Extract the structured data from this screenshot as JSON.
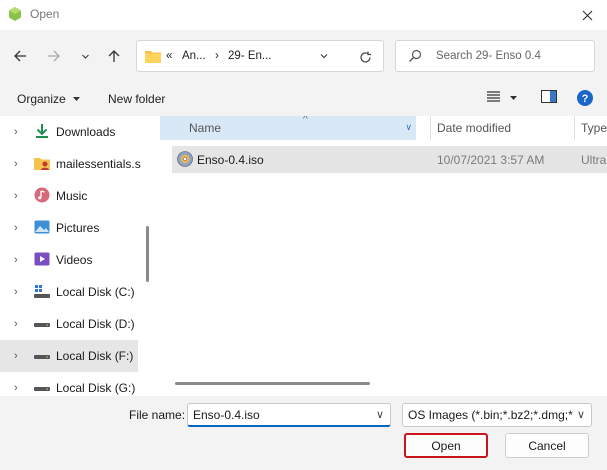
{
  "window": {
    "title": "Open"
  },
  "nav": {
    "breadcrumb_overflow": "«",
    "breadcrumbs": [
      "An...",
      "29- En..."
    ],
    "separator": "›",
    "search_placeholder": "Search 29- Enso 0.4"
  },
  "toolbar": {
    "organize_label": "Organize",
    "new_folder_label": "New folder"
  },
  "sidebar": {
    "items": [
      {
        "label": "Downloads",
        "icon": "download-icon"
      },
      {
        "label": "mailessentials.s",
        "icon": "user-folder-icon"
      },
      {
        "label": "Music",
        "icon": "music-icon"
      },
      {
        "label": "Pictures",
        "icon": "pictures-icon"
      },
      {
        "label": "Videos",
        "icon": "videos-icon"
      },
      {
        "label": "Local Disk (C:)",
        "icon": "windows-drive-icon"
      },
      {
        "label": "Local Disk (D:)",
        "icon": "drive-icon"
      },
      {
        "label": "Local Disk (F:)",
        "icon": "drive-icon",
        "selected": true
      },
      {
        "label": "Local Disk (G:)",
        "icon": "drive-icon"
      }
    ]
  },
  "filelist": {
    "columns": {
      "name": "Name",
      "date": "Date modified",
      "type": "Type"
    },
    "rows": [
      {
        "name": "Enso-0.4.iso",
        "date": "10/07/2021 3:57 AM",
        "type": "Ultra",
        "icon": "disc-image-icon"
      }
    ]
  },
  "bottom": {
    "filename_label": "File name:",
    "filename_value": "Enso-0.4.iso",
    "filetype_value": "OS Images (*.bin;*.bz2;*.dmg;*.",
    "open_label": "Open",
    "cancel_label": "Cancel"
  },
  "colors": {
    "accent": "#0a64c4",
    "highlight_border": "#c8151b",
    "header_selected": "#d9e8f7"
  }
}
